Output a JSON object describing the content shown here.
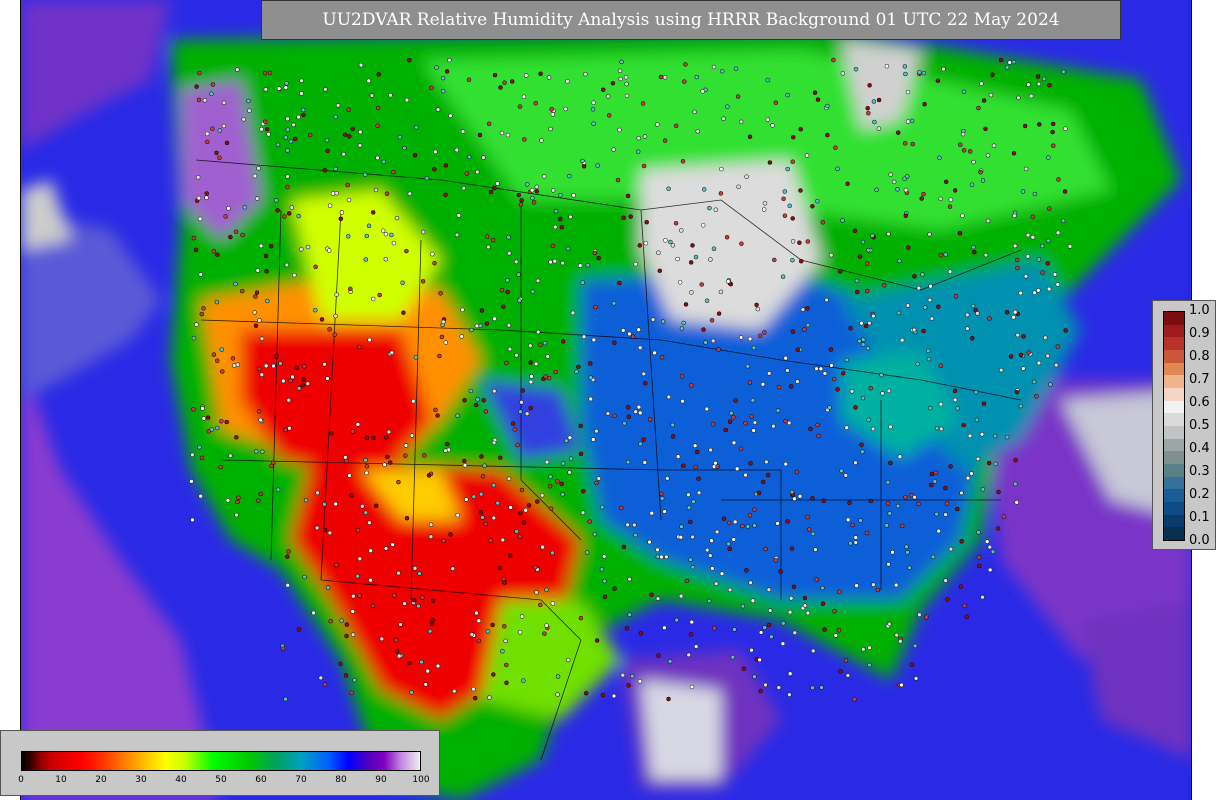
{
  "title": "UU2DVAR Relative Humidity Analysis using HRRR Background 01 UTC 22 May 2024",
  "rh_legend": {
    "ticks": [
      "1.0",
      "0.9",
      "0.8",
      "0.7",
      "0.6",
      "0.5",
      "0.4",
      "0.3",
      "0.2",
      "0.1",
      "0.0"
    ],
    "colors": [
      "#7a0d12",
      "#9e1a1c",
      "#b8312a",
      "#c9573a",
      "#e0884f",
      "#f0b48c",
      "#f6d5c4",
      "#f2f2f2",
      "#dadada",
      "#c0c4c4",
      "#9aa6a6",
      "#7f9090",
      "#5b7f86",
      "#37709a",
      "#1a5d96",
      "#0d4b82",
      "#083a6a",
      "#05304f"
    ]
  },
  "pct_legend": {
    "ticks": [
      "0",
      "10",
      "20",
      "30",
      "40",
      "50",
      "60",
      "70",
      "80",
      "90",
      "100"
    ]
  },
  "colors": {
    "ocean": "#2a2ae6",
    "outside_domain": "#cccccc",
    "dry": "#ff0000",
    "moderate": "#00c800",
    "moist": "#0a5fd8",
    "saturated": "#e8e8e8"
  }
}
